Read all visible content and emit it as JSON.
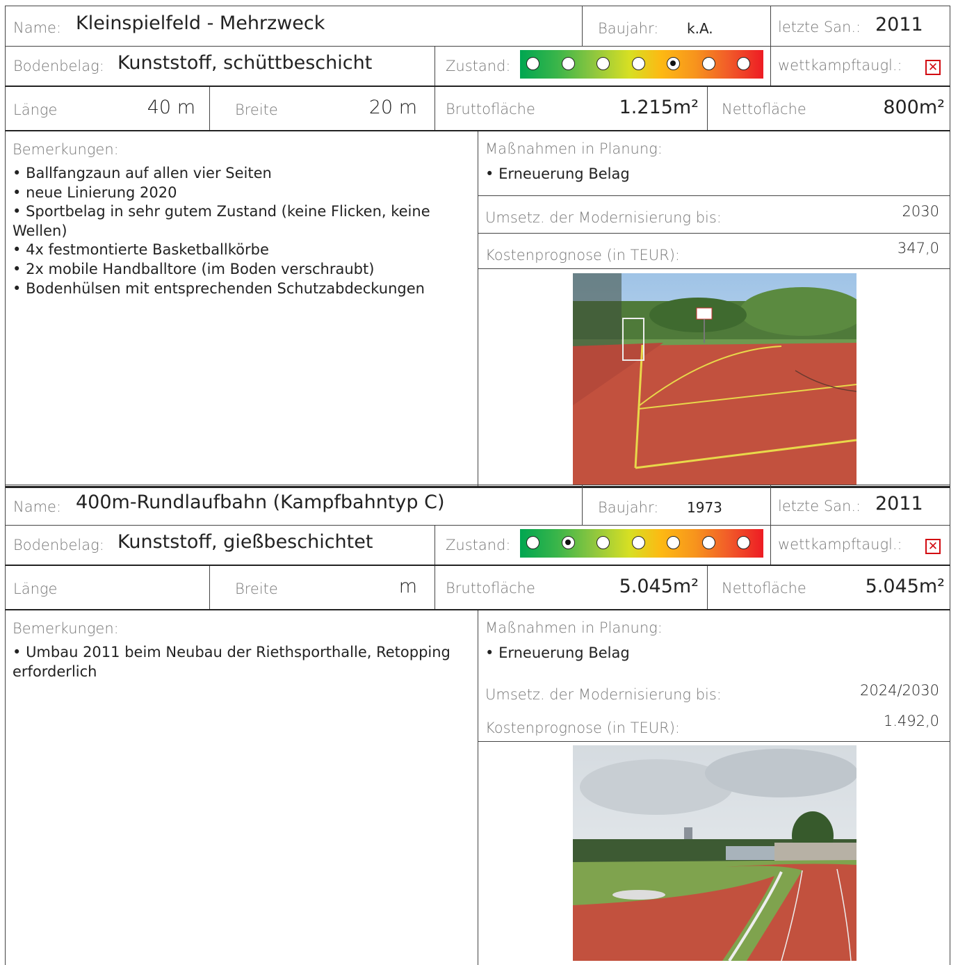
{
  "labels": {
    "name": "Name:",
    "baujahr": "Baujahr:",
    "letzte_san": "letzte San.:",
    "bodenbelag": "Bodenbelag:",
    "zustand": "Zustand:",
    "wettkampf": "wettkampftaugl.:",
    "laenge": "Länge",
    "breite": "Breite",
    "brutto": "Bruttofläche",
    "netto": "Nettofläche",
    "bemerkungen": "Bemerkungen:",
    "massnahmen": "Maßnahmen in Planung:",
    "umsetzung": "Umsetz. der Modernisierung bis:",
    "kosten": "Kostenprognose (in TEUR):"
  },
  "facilities": [
    {
      "name": "Kleinspielfeld - Mehrzweck",
      "baujahr": "k.A.",
      "letzte_san": "2011",
      "bodenbelag": "Kunststoff, schüttbeschicht",
      "zustand_level": 5,
      "zustand_scale": 7,
      "wettkampf_mark": "✕",
      "laenge": "40 m",
      "breite": "20 m",
      "brutto": "1.215m²",
      "netto": "800m²",
      "bemerkungen": [
        "Ballfangzaun auf allen vier Seiten",
        "neue Linierung 2020",
        "Sportbelag in sehr gutem Zustand (keine Flicken, keine Wellen)",
        "4x festmontierte Basketballkörbe",
        "2x mobile Handballtore (im Boden verschraubt)",
        "Bodenhülsen mit entsprechenden Schutzabdeckungen"
      ],
      "massnahmen": [
        "Erneuerung Belag"
      ],
      "umsetzung": "2030",
      "kosten": "347,0"
    },
    {
      "name": "400m-Rundlaufbahn (Kampfbahntyp C)",
      "baujahr": "1973",
      "letzte_san": "2011",
      "bodenbelag": "Kunststoff, gießbeschichtet",
      "zustand_level": 2,
      "zustand_scale": 7,
      "wettkampf_mark": "✕",
      "laenge": "",
      "breite": "m",
      "brutto": "5.045m²",
      "netto": "5.045m²",
      "bemerkungen": [
        "Umbau 2011 beim Neubau der Riethsporthalle, Retopping erforderlich"
      ],
      "massnahmen": [
        "Erneuerung Belag"
      ],
      "umsetzung": "2024/2030",
      "kosten": "1.492,0"
    }
  ],
  "colors": {
    "border": "#444444",
    "card2_bg": "#f2f2f2",
    "red_mark": "#d20a11",
    "track": "#c2513e"
  }
}
